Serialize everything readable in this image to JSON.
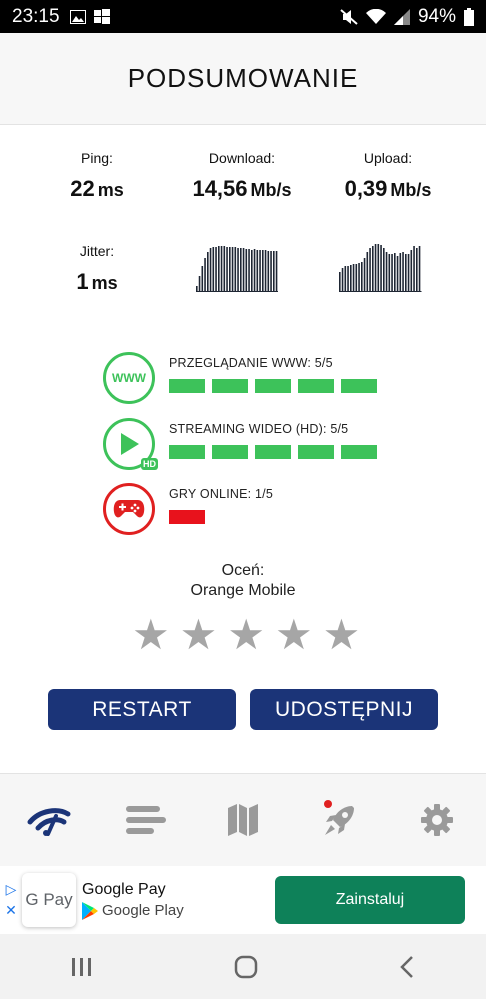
{
  "status_bar": {
    "time": "23:15",
    "battery": "94%"
  },
  "header": {
    "title": "PODSUMOWANIE"
  },
  "stats": {
    "ping": {
      "label": "Ping:",
      "value": "22",
      "unit": "ms"
    },
    "download": {
      "label": "Download:",
      "value": "14,56",
      "unit": "Mb/s"
    },
    "upload": {
      "label": "Upload:",
      "value": "0,39",
      "unit": "Mb/s"
    },
    "jitter": {
      "label": "Jitter:",
      "value": "1",
      "unit": "ms"
    }
  },
  "graphs": {
    "download": [
      6,
      16,
      26,
      34,
      40,
      44,
      45,
      45,
      46,
      46,
      46,
      45,
      45,
      45,
      45,
      44,
      44,
      44,
      43,
      43,
      42,
      43,
      42,
      42,
      42,
      42,
      41,
      41,
      41,
      41
    ],
    "upload": [
      20,
      24,
      26,
      26,
      27,
      28,
      28,
      29,
      30,
      34,
      40,
      44,
      46,
      48,
      48,
      47,
      44,
      40,
      38,
      38,
      39,
      36,
      39,
      40,
      38,
      38,
      42,
      46,
      44,
      46
    ]
  },
  "categories": [
    {
      "label": "PRZEGLĄDANIE WWW: 5/5",
      "score": 5,
      "max": 5,
      "icon": "www-icon",
      "color": "#3dc25a"
    },
    {
      "label": "STREAMING WIDEO (HD): 5/5",
      "score": 5,
      "max": 5,
      "icon": "play-hd-icon",
      "color": "#3dc25a"
    },
    {
      "label": "GRY ONLINE: 1/5",
      "score": 1,
      "max": 5,
      "icon": "gamepad-icon",
      "color": "#e8121c"
    }
  ],
  "category_icon_texts": {
    "www": "WWW",
    "hd": "HD"
  },
  "rating": {
    "label": "Oceń:",
    "operator": "Orange Mobile",
    "stars_total": 5,
    "stars_filled": 0
  },
  "buttons": {
    "restart": "RESTART",
    "share": "UDOSTĘPNIJ"
  },
  "nav": [
    "speed-icon",
    "list-icon",
    "map-icon",
    "rocket-icon",
    "gear-icon"
  ],
  "ad": {
    "app_name": "Google Pay",
    "store": "Google Play",
    "logo_text": "G Pay",
    "install": "Zainstaluj"
  },
  "colors": {
    "accent": "#1b3478",
    "good": "#3dc25a",
    "bad": "#e8121c",
    "install": "#0e8159"
  }
}
